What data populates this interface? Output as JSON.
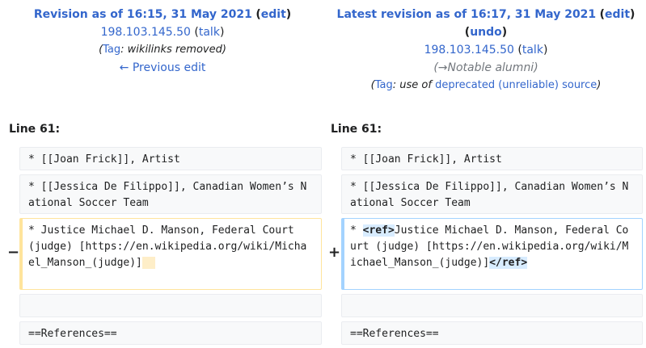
{
  "left_header": {
    "title": "Revision as of 16:15, 31 May 2021",
    "edit": "edit",
    "user": "198.103.145.50",
    "talk": "talk",
    "tag_label": "Tag",
    "tag_value": "wikilinks removed",
    "prev_edit": "← Previous edit"
  },
  "right_header": {
    "title": "Latest revision as of 16:17, 31 May 2021",
    "edit": "edit",
    "undo": "undo",
    "user": "198.103.145.50",
    "talk": "talk",
    "section": "→Notable alumni",
    "tag_label": "Tag",
    "tag_prefix": "use of",
    "tag_link": "deprecated (unreliable) source"
  },
  "diff": {
    "left_line": "Line 61:",
    "right_line": "Line 61:",
    "minus": "−",
    "plus": "+",
    "row1": "* [[Joan Frick]], Artist",
    "row2": "* [[Jessica De Filippo]], Canadian Women’s National Soccer Team",
    "row3_left": "* Justice Michael D. Manson, Federal Court (judge) [https://en.wikipedia.org/wiki/Michael_Manson_(judge)]",
    "row3_right_prefix": "* ",
    "ref_open": "<ref>",
    "row3_right_body": "Justice Michael D. Manson, Federal Court (judge) [https://en.wikipedia.org/wiki/Michael_Manson_(judge)]",
    "ref_close": "</ref>",
    "row5": "==References=="
  }
}
